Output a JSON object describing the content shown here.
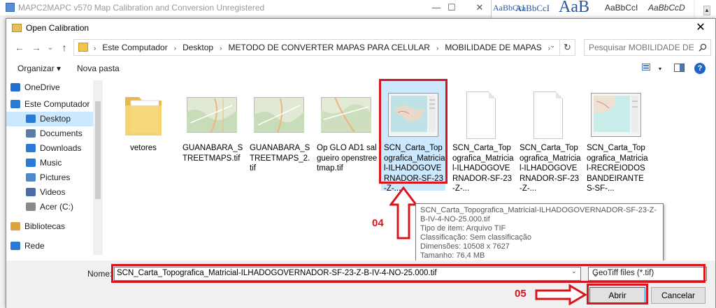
{
  "background_app": {
    "title": "MAPC2MAPC  v570 Map Calibration and Conversion Unregistered",
    "controls": [
      "—",
      "☐",
      "✕"
    ],
    "word_styles": [
      "AaBbCcI",
      "AaBbCcI",
      "AaB",
      "AaBbCcI",
      "AaBbCcD"
    ]
  },
  "dialog": {
    "title": "Open Calibration",
    "close": "✕",
    "nav": {
      "back": "←",
      "forward": "→",
      "dropdown": "⌄",
      "up": "↑"
    },
    "breadcrumbs": [
      "Este Computador",
      "Desktop",
      "METODO DE CONVERTER MAPAS PARA CELULAR",
      "MOBILIDADE DE MAPAS"
    ],
    "search": {
      "placeholder": "Pesquisar MOBILIDADE DE M..."
    },
    "toolbar": {
      "organize": "Organizar ▾",
      "new_folder": "Nova pasta",
      "help": "?"
    },
    "sidebar": [
      {
        "label": "OneDrive",
        "icon": "onedrive-icon",
        "color": "#1f6fd1"
      },
      {
        "label": "Este Computador",
        "icon": "computer-icon",
        "color": "#2a7bd5"
      },
      {
        "label": "Desktop",
        "icon": "desktop-icon",
        "color": "#2a7bd5",
        "selected": true
      },
      {
        "label": "Documents",
        "icon": "documents-icon",
        "color": "#5a7ea6"
      },
      {
        "label": "Downloads",
        "icon": "downloads-icon",
        "color": "#2a7bd5"
      },
      {
        "label": "Music",
        "icon": "music-icon",
        "color": "#2a7bd5"
      },
      {
        "label": "Pictures",
        "icon": "pictures-icon",
        "color": "#4b8ad0"
      },
      {
        "label": "Videos",
        "icon": "videos-icon",
        "color": "#4a6aa8"
      },
      {
        "label": "Acer (C:)",
        "icon": "drive-icon",
        "color": "#8a8a8a"
      },
      {
        "label": "Bibliotecas",
        "icon": "libraries-icon",
        "color": "#d9a441"
      },
      {
        "label": "Rede",
        "icon": "network-icon",
        "color": "#2a7bd5"
      }
    ],
    "files": [
      {
        "name": "vetores",
        "kind": "folder"
      },
      {
        "name": "GUANABARA_STREETMAPS.tif",
        "kind": "map"
      },
      {
        "name": "GUANABARA_STREETMAPS_2.tif",
        "kind": "map"
      },
      {
        "name": "Op GLO AD1 salgueiro openstreetmap.tif",
        "kind": "map"
      },
      {
        "name": "SCN_Carta_Topografica_Matricial-ILHADOGOVERNADOR-SF-23-Z-...",
        "kind": "topo",
        "selected": true
      },
      {
        "name": "SCN_Carta_Topografica_Matricial-ILHADOGOVERNADOR-SF-23-Z-...",
        "kind": "blank"
      },
      {
        "name": "SCN_Carta_Topografica_Matricial-ILHADOGOVERNADOR-SF-23-Z-...",
        "kind": "blank"
      },
      {
        "name": "SCN_Carta_Topografica_Matricial-RECREIODOSBANDEIRANTES-SF-...",
        "kind": "topo2"
      }
    ],
    "tooltip": {
      "name": "SCN_Carta_Topografica_Matricial-ILHADOGOVERNADOR-SF-23-Z-B-IV-4-NO-25.000.tif",
      "type": "Tipo de item: Arquivo TIF",
      "rating": "Classificação: Sem classificação",
      "dimensions": "Dimensões: 10508 x 7627",
      "size": "Tamanho: 76,4 MB"
    },
    "annotations": {
      "step4": "04",
      "step5": "05"
    },
    "bottom": {
      "name_label": "Nome:",
      "file_name": "SCN_Carta_Topografica_Matricial-ILHADOGOVERNADOR-SF-23-Z-B-IV-4-NO-25.000.tif",
      "file_type": "GeoTiff files (*.tif)",
      "open": "Abrir",
      "cancel": "Cancelar"
    },
    "colors": {
      "accent": "#0078d7",
      "selection": "#cce8ff",
      "annotation": "#d9141c"
    }
  }
}
